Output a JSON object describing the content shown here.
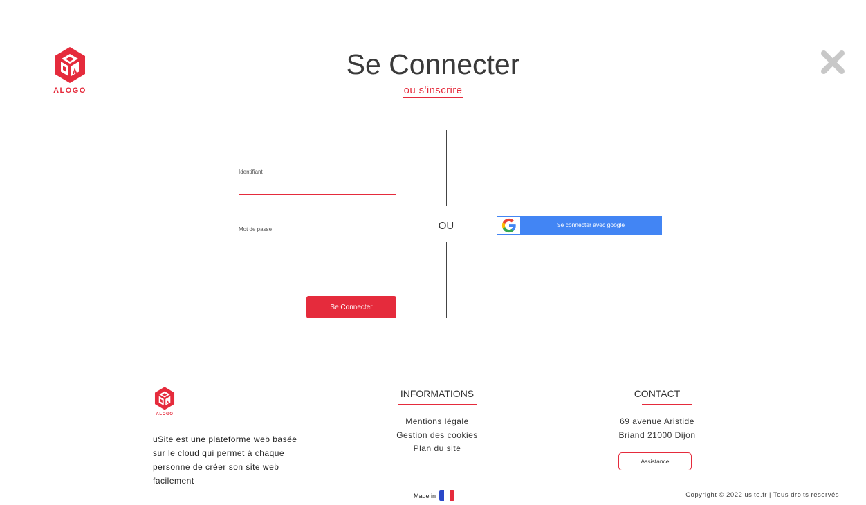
{
  "header": {
    "logo_text": "ALOGO",
    "title": "Se Connecter",
    "subtitle_link": "ou s'inscrire"
  },
  "form": {
    "username_label": "Identifiant",
    "username_value": "",
    "password_label": "Mot de passe",
    "password_value": "",
    "submit_label": "Se Connecter"
  },
  "separator": {
    "text": "OU"
  },
  "google": {
    "label": "Se connecter avec google"
  },
  "footer": {
    "logo_text": "ALOGO",
    "description": "uSite est une plateforme web basée sur le cloud qui permet à chaque personne de créer son site web facilement",
    "informations": {
      "title": "INFORMATIONS",
      "links": [
        "Mentions légale",
        "Gestion des cookies",
        "Plan du site"
      ]
    },
    "contact": {
      "title": "CONTACT",
      "address_line1": "69 avenue Aristide",
      "address_line2": "Briand 21000 Dijon",
      "assistance_label": "Assistance"
    },
    "made_in": "Made in",
    "copyright": "Copyright © 2022 usite.fr | Tous droits réservés"
  },
  "colors": {
    "accent": "#e52b3c",
    "google_blue": "#4285f4",
    "flag": [
      "#2b48c8",
      "#ffffff",
      "#e52b3c"
    ]
  },
  "icons": {
    "logo": "cube-logo-icon",
    "close": "close-x-icon",
    "google": "google-g-icon",
    "flag": "france-flag-icon"
  }
}
